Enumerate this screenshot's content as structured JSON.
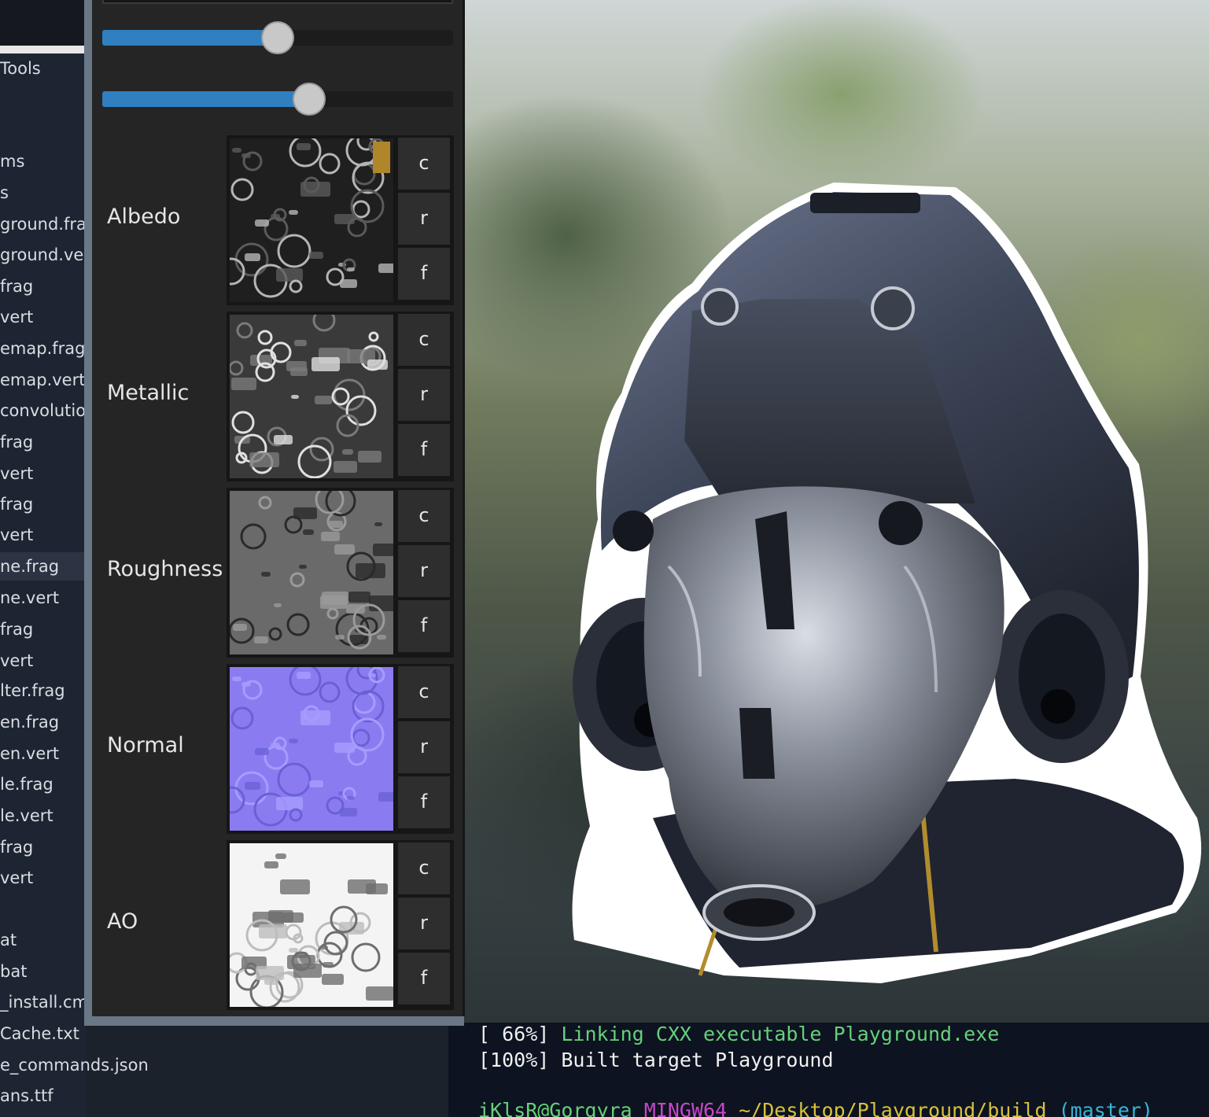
{
  "explorer": {
    "items": [
      "Tools",
      "ms",
      "s",
      "ground.fra",
      "ground.ver",
      "frag",
      "vert",
      "emap.frag",
      "emap.vert",
      "convolutio",
      "frag",
      "vert",
      "frag",
      "vert",
      "ne.frag",
      "ne.vert",
      "frag",
      "vert",
      "lter.frag",
      "en.frag",
      "en.vert",
      "le.frag",
      "le.vert",
      "frag",
      "vert",
      "at",
      "bat",
      "_install.cma",
      "Cache.txt",
      "e_commands.json",
      "ans.ttf"
    ]
  },
  "sliders": [
    {
      "name": "slider-1",
      "fraction": 0.5
    },
    {
      "name": "slider-2",
      "fraction": 0.59
    }
  ],
  "materials": [
    {
      "label": "Albedo",
      "kind": "albedo",
      "buttons": [
        "c",
        "r",
        "f"
      ]
    },
    {
      "label": "Metallic",
      "kind": "metallic",
      "buttons": [
        "c",
        "r",
        "f"
      ]
    },
    {
      "label": "Roughness",
      "kind": "roughness",
      "buttons": [
        "c",
        "r",
        "f"
      ]
    },
    {
      "label": "Normal",
      "kind": "normal",
      "buttons": [
        "c",
        "r",
        "f"
      ]
    },
    {
      "label": "AO",
      "kind": "ao",
      "buttons": [
        "c",
        "r",
        "f"
      ]
    }
  ],
  "terminal": {
    "line1_prefix": "[ 66%] ",
    "line1_msg": "Linking CXX executable Playground.exe",
    "line2": "[100%] Built target Playground",
    "prompt_user": "iKlsR@Gorgyra",
    "prompt_env": "MINGW64",
    "prompt_path": "~/Desktop/Playground/build",
    "prompt_branch": "(master)"
  },
  "colors": {
    "slider_fill": "#2f7fc1",
    "panel_bg": "#252525",
    "normal_map": "#8a7cf0",
    "terminal_green": "#67d07a",
    "terminal_purple": "#c548c8",
    "terminal_yellow": "#d6c23c",
    "terminal_cyan": "#37b4d6"
  }
}
